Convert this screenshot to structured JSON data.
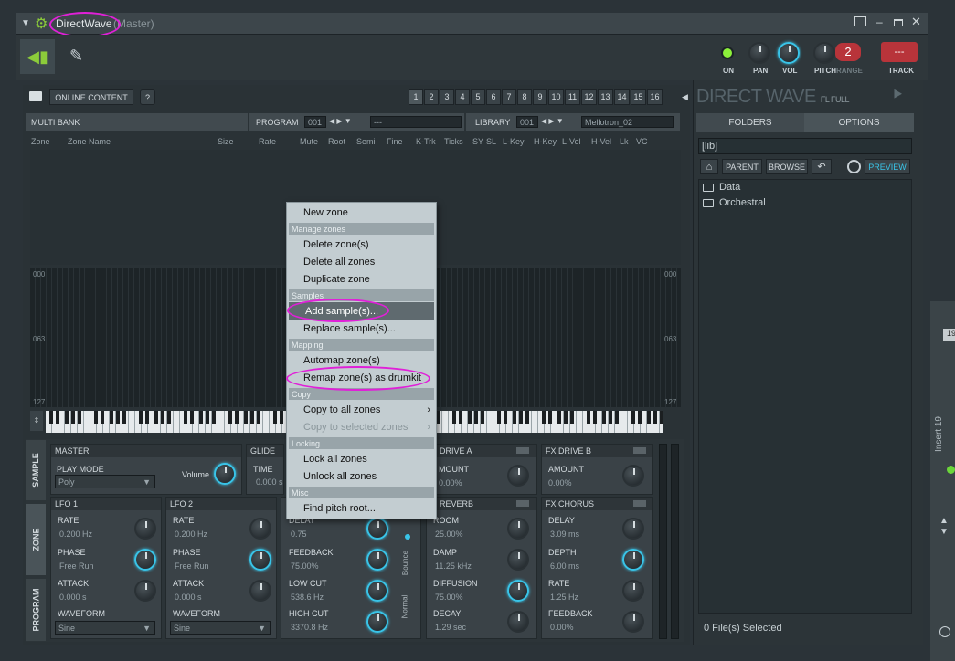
{
  "titlebar": {
    "plugin": "DirectWave",
    "suffix": "(Master)"
  },
  "mixer": {
    "on": "ON",
    "pan": "PAN",
    "vol": "VOL",
    "pitch": "PITCH",
    "range": "RANGE",
    "range_value": "2",
    "track": "TRACK",
    "track_value": "---"
  },
  "toolbar": {
    "online_content": "ONLINE CONTENT",
    "help": "?"
  },
  "pages": [
    "1",
    "2",
    "3",
    "4",
    "5",
    "6",
    "7",
    "8",
    "9",
    "10",
    "11",
    "12",
    "13",
    "14",
    "15",
    "16"
  ],
  "bank": {
    "multi_bank": "MULTI BANK",
    "program": "PROGRAM",
    "program_num": "001",
    "program_name": "---",
    "library": "LIBRARY",
    "library_num": "001",
    "library_name": "Mellotron_02"
  },
  "columns": [
    "Zone",
    "Zone Name",
    "Size",
    "Rate",
    "Mute",
    "Root",
    "Semi",
    "Fine",
    "K-Trk",
    "Ticks",
    "SY",
    "SL",
    "L-Key",
    "H-Key",
    "L-Vel",
    "H-Vel",
    "Lk",
    "VC"
  ],
  "velocity_labels": [
    "000",
    "063",
    "127"
  ],
  "browser": {
    "brand": "DIRECT WAVE",
    "brand_sub": "FL FULL",
    "folders_tab": "FOLDERS",
    "options_tab": "OPTIONS",
    "path": "[lib]",
    "parent": "PARENT",
    "browse": "BROWSE",
    "preview": "PREVIEW",
    "items": [
      "Data",
      "Orchestral"
    ],
    "status": "0 File(s) Selected"
  },
  "side_tabs": [
    "SAMPLE",
    "ZONE",
    "PROGRAM"
  ],
  "master": {
    "title": "MASTER",
    "play_mode_label": "PLAY MODE",
    "play_mode": "Poly",
    "volume": "Volume"
  },
  "glide": {
    "title": "GLIDE",
    "time_label": "TIME",
    "time_value": "0.000 s"
  },
  "lfo1": {
    "title": "LFO 1",
    "rate": "RATE",
    "rate_v": "0.200 Hz",
    "phase": "PHASE",
    "phase_v": "Free Run",
    "attack": "ATTACK",
    "attack_v": "0.000 s",
    "waveform": "WAVEFORM",
    "waveform_v": "Sine"
  },
  "lfo2": {
    "title": "LFO 2",
    "rate": "RATE",
    "rate_v": "0.200 Hz",
    "phase": "PHASE",
    "phase_v": "Free Run",
    "attack": "ATTACK",
    "attack_v": "0.000 s",
    "waveform": "WAVEFORM",
    "waveform_v": "Sine"
  },
  "delay": {
    "delay": "DELAY",
    "delay_v": "0.75",
    "feedback": "FEEDBACK",
    "feedback_v": "75.00%",
    "lowcut": "LOW CUT",
    "lowcut_v": "538.6 Hz",
    "highcut": "HIGH CUT",
    "highcut_v": "3370.8 Hz",
    "bounce": "Bounce",
    "normal": "Normal"
  },
  "fx_drive_a": {
    "title": "DRIVE A",
    "amount": "MOUNT",
    "amount_v": "0.00%"
  },
  "fx_drive_b": {
    "title": "FX DRIVE B",
    "amount": "AMOUNT",
    "amount_v": "0.00%"
  },
  "reverb": {
    "title": "REVERB",
    "room": "ROOM",
    "room_v": "25.00%",
    "damp": "DAMP",
    "damp_v": "11.25 kHz",
    "diffusion": "DIFFUSION",
    "diffusion_v": "75.00%",
    "decay": "DECAY",
    "decay_v": "1.29 sec"
  },
  "chorus": {
    "title": "FX CHORUS",
    "delay": "DELAY",
    "delay_v": "3.09 ms",
    "depth": "DEPTH",
    "depth_v": "6.00 ms",
    "rate": "RATE",
    "rate_v": "1.25 Hz",
    "feedback": "FEEDBACK",
    "feedback_v": "0.00%"
  },
  "context_menu": {
    "new_zone": "New zone",
    "h_manage": "Manage zones",
    "delete_zones": "Delete zone(s)",
    "delete_all": "Delete all zones",
    "duplicate": "Duplicate zone",
    "h_samples": "Samples",
    "add_sample": "Add sample(s)...",
    "replace_sample": "Replace sample(s)...",
    "h_mapping": "Mapping",
    "automap": "Automap zone(s)",
    "remap_drumkit": "Remap zone(s) as drumkit",
    "h_copy": "Copy",
    "copy_all": "Copy to all zones",
    "copy_selected": "Copy to selected zones",
    "h_locking": "Locking",
    "lock_all": "Lock all zones",
    "unlock_all": "Unlock all zones",
    "h_misc": "Misc",
    "find_pitch": "Find pitch root..."
  },
  "right_strip": {
    "insert": "Insert 19",
    "num": "19"
  },
  "colors": {
    "accent": "#39c4e8",
    "highlight": "#e020d8",
    "panel": "#3a4247"
  }
}
